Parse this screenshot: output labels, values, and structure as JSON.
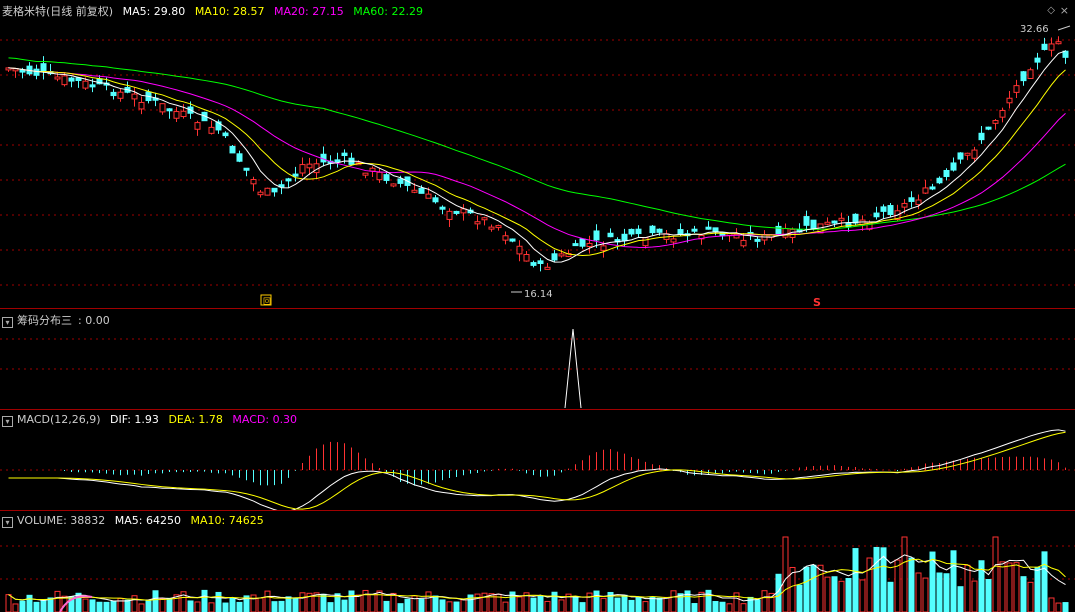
{
  "main": {
    "title": "麦格米特(日线 前复权)",
    "ma": [
      {
        "label": "MA5: 29.80",
        "color": "#ffffff"
      },
      {
        "label": "MA10: 28.57",
        "color": "#ffff00"
      },
      {
        "label": "MA20: 27.15",
        "color": "#ff00ff"
      },
      {
        "label": "MA60: 22.29",
        "color": "#00ff00"
      }
    ],
    "high_label": "32.66",
    "low_label": "16.14",
    "signal_glyph": "S",
    "marker_glyph": "回"
  },
  "chip": {
    "title": "筹码分布三",
    "value": ": 0.00"
  },
  "macd": {
    "title": "MACD(12,26,9)",
    "dif": "DIF: 1.93",
    "dea": "DEA: 1.78",
    "macd": "MACD: 0.30"
  },
  "volume": {
    "title": "VOLUME: 38832",
    "ma5": "MA5: 64250",
    "ma10": "MA10: 74625"
  },
  "colors": {
    "up": "#ff3232",
    "down": "#54ffff",
    "ma5": "#ffffff",
    "ma10": "#ffff00",
    "ma20": "#ff00ff",
    "ma60": "#00ff00",
    "grid": "#a00000"
  }
}
